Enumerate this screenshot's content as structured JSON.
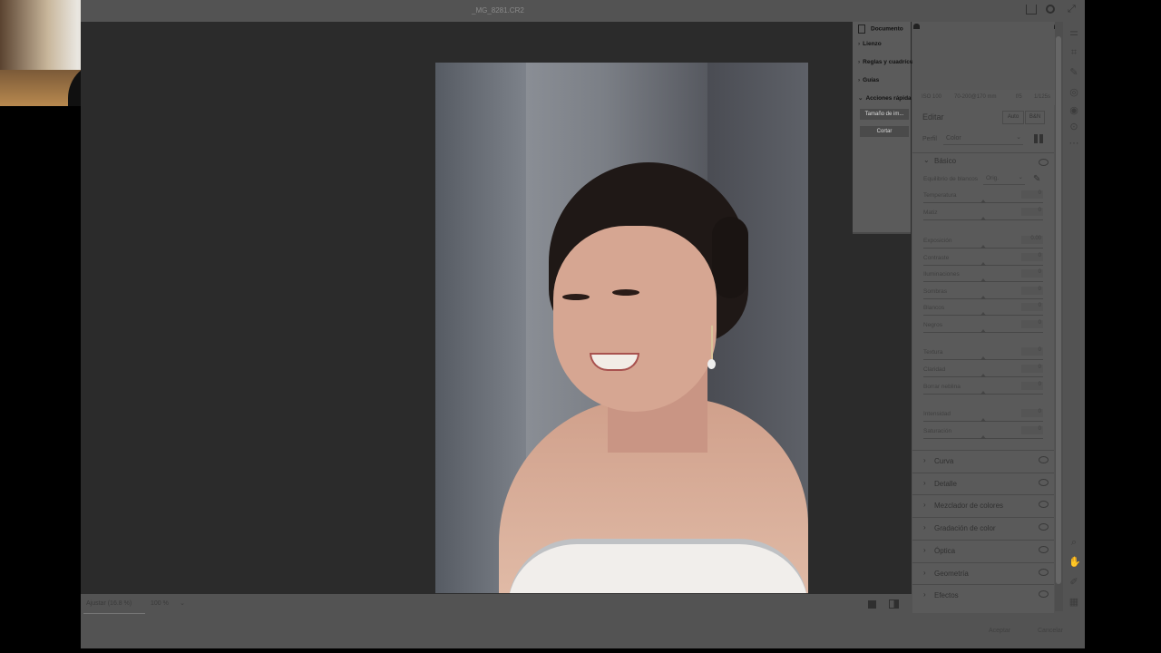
{
  "window": {
    "title": "_MG_8281.CR2"
  },
  "left_panel": {
    "items": [
      {
        "label": "Documento"
      },
      {
        "label": "Lienzo"
      },
      {
        "label": "Reglas y cuadrículas"
      },
      {
        "label": "Guías"
      },
      {
        "label": "Acciones rápida"
      }
    ],
    "buttons": [
      {
        "label": "Tamaño de im..."
      },
      {
        "label": "Cortar"
      }
    ]
  },
  "camera_info": {
    "iso": "ISO 100",
    "lens": "70-200@170 mm",
    "aperture": "f/5",
    "shutter": "1/125s"
  },
  "edit": {
    "title": "Editar",
    "auto_label": "Auto",
    "bw_label": "B&N",
    "profile_label": "Perfil",
    "profile_value": "Color",
    "basic": {
      "title": "Básico",
      "wb_label": "Equilibrio de blancos",
      "wb_value": "Orig.",
      "sliders": [
        {
          "label": "Temperatura",
          "value": "0",
          "pos": 0.5
        },
        {
          "label": "Matiz",
          "value": "0",
          "pos": 0.5
        },
        {
          "label": "Exposición",
          "value": "0.00",
          "pos": 0.5
        },
        {
          "label": "Contraste",
          "value": "0",
          "pos": 0.5
        },
        {
          "label": "Iluminaciones",
          "value": "0",
          "pos": 0.5
        },
        {
          "label": "Sombras",
          "value": "0",
          "pos": 0.5
        },
        {
          "label": "Blancos",
          "value": "0",
          "pos": 0.5
        },
        {
          "label": "Negros",
          "value": "0",
          "pos": 0.5
        },
        {
          "label": "Textura",
          "value": "0",
          "pos": 0.5
        },
        {
          "label": "Claridad",
          "value": "0",
          "pos": 0.5
        },
        {
          "label": "Borrar neblina",
          "value": "0",
          "pos": 0.5
        },
        {
          "label": "Intensidad",
          "value": "0",
          "pos": 0.5
        },
        {
          "label": "Saturación",
          "value": "0",
          "pos": 0.5
        }
      ]
    },
    "sections": [
      {
        "label": "Curva"
      },
      {
        "label": "Detalle"
      },
      {
        "label": "Mezclador de colores"
      },
      {
        "label": "Gradación de color"
      },
      {
        "label": "Óptica"
      },
      {
        "label": "Geometría"
      },
      {
        "label": "Efectos"
      }
    ]
  },
  "bottom_bar": {
    "fit_label": "Ajustar (16.8 %)",
    "zoom": "100 %"
  },
  "footer": {
    "accept": "Aceptar",
    "cancel": "Cancelar"
  }
}
